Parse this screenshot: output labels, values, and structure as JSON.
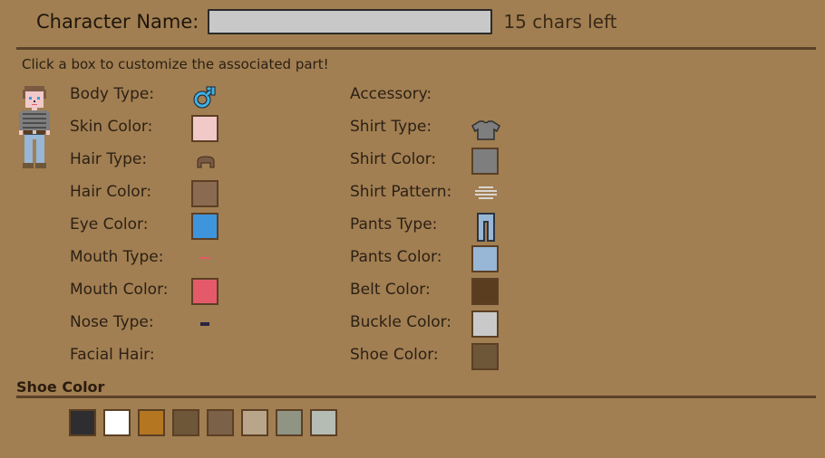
{
  "header": {
    "name_label": "Character Name:",
    "name_value": "",
    "chars_left": "15 chars left"
  },
  "hint": "Click a box to customize the associated part!",
  "left_options": [
    {
      "label": "Body Type:",
      "kind": "icon",
      "icon": "male-icon"
    },
    {
      "label": "Skin Color:",
      "kind": "swatch",
      "color": "#f1c9c9"
    },
    {
      "label": "Hair Type:",
      "kind": "icon",
      "icon": "hair-icon"
    },
    {
      "label": "Hair Color:",
      "kind": "swatch",
      "color": "#8a6a50"
    },
    {
      "label": "Eye Color:",
      "kind": "swatch",
      "color": "#3f95dc"
    },
    {
      "label": "Mouth Type:",
      "kind": "icon",
      "icon": "mouth-icon"
    },
    {
      "label": "Mouth Color:",
      "kind": "swatch",
      "color": "#e45a6a"
    },
    {
      "label": "Nose Type:",
      "kind": "icon",
      "icon": "nose-icon"
    },
    {
      "label": "Facial Hair:",
      "kind": "none"
    }
  ],
  "right_options": [
    {
      "label": "Accessory:",
      "kind": "none"
    },
    {
      "label": "Shirt Type:",
      "kind": "icon",
      "icon": "shirt-icon"
    },
    {
      "label": "Shirt Color:",
      "kind": "swatch",
      "color": "#7e7e7e"
    },
    {
      "label": "Shirt Pattern:",
      "kind": "icon",
      "icon": "pattern-icon"
    },
    {
      "label": "Pants Type:",
      "kind": "icon",
      "icon": "pants-icon"
    },
    {
      "label": "Pants Color:",
      "kind": "swatch",
      "color": "#98b6d6"
    },
    {
      "label": "Belt Color:",
      "kind": "swatch",
      "color": "#5a3c1f"
    },
    {
      "label": "Buckle Color:",
      "kind": "swatch",
      "color": "#c9c9c9"
    },
    {
      "label": "Shoe Color:",
      "kind": "swatch",
      "color": "#6e5639"
    }
  ],
  "palette": {
    "title": "Shoe Color",
    "colors": [
      "#2e2e30",
      "#ffffff",
      "#b57622",
      "#6e5639",
      "#7a6147",
      "#b9a589",
      "#8f9483",
      "#b5bcb3"
    ]
  }
}
